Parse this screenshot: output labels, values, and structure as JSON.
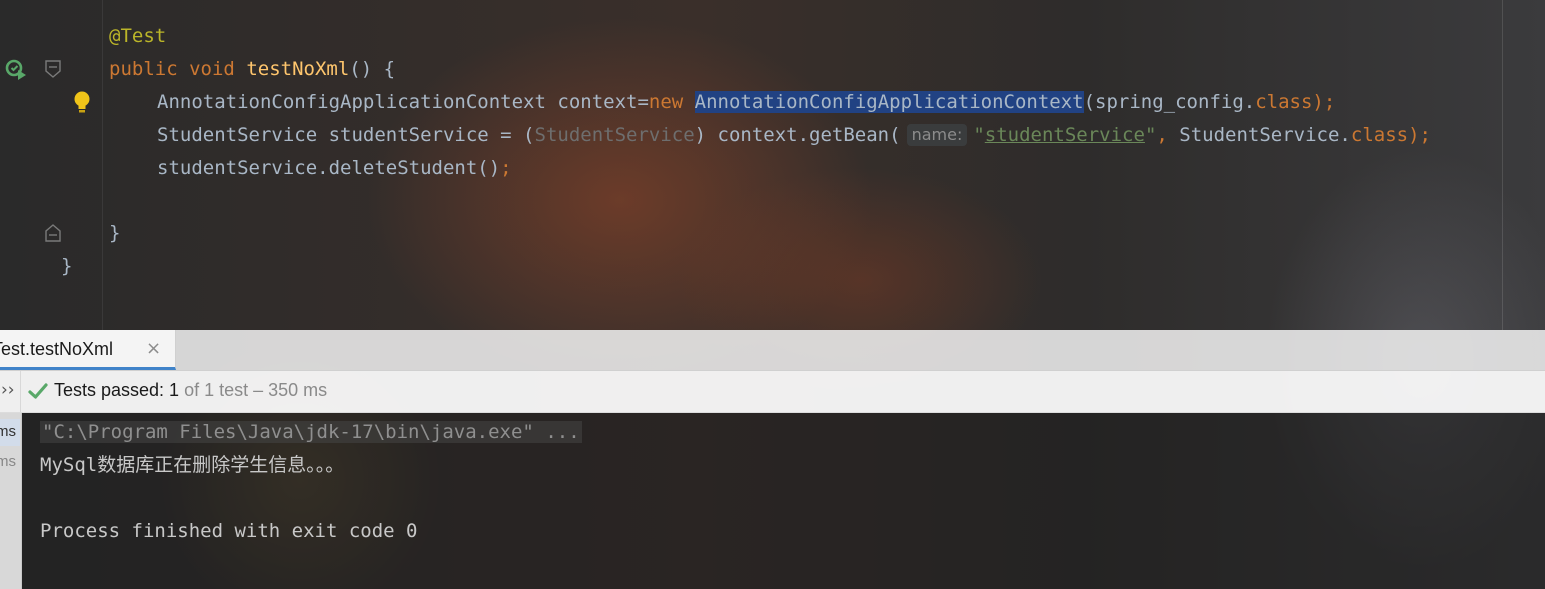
{
  "editor": {
    "lines": {
      "l1": "@Test",
      "l2": {
        "kw1": "public",
        "kw2": "void",
        "fn": "testNoXml",
        "rest": "() {"
      },
      "l3": {
        "type": "AnnotationConfigApplicationContext",
        "var": " context=",
        "kw": "new",
        "sel": "AnnotationConfigApplicationContext",
        "arg": "(spring_config.",
        "cls": "class",
        "end": ");"
      },
      "l4": {
        "a": "StudentService studentService = (",
        "cast": "StudentService",
        "b": ") context.getBean(",
        "hint": "name:",
        "q1": "\"",
        "str": "studentService",
        "q2": "\"",
        "comma": ",",
        "c": " StudentService.",
        "cls": "class",
        "end": ");"
      },
      "l5": {
        "a": "studentService.deleteStudent()",
        "end": ";"
      },
      "l7": "}",
      "l8": "}"
    }
  },
  "run_panel": {
    "tab_label": "nTest.testNoXml",
    "tab_close": "×",
    "chevron": "››",
    "status_main": "Tests passed: 1",
    "status_rest": " of 1 test – 350 ms",
    "tree_times": [
      "ms",
      "ms"
    ],
    "console": {
      "cmd": "\"C:\\Program Files\\Java\\jdk-17\\bin\\java.exe\" ...",
      "out_latin": "MySql",
      "out_cjk": "数据库正在删除学生信息。。。",
      "exit": "Process finished with exit code 0"
    }
  },
  "colors": {
    "keyword": "#cc7832",
    "annotation": "#bbb529",
    "function": "#ffc66d",
    "string": "#6a8759",
    "selection": "#214283",
    "success": "#59a869",
    "tab_underline": "#4083c9"
  }
}
